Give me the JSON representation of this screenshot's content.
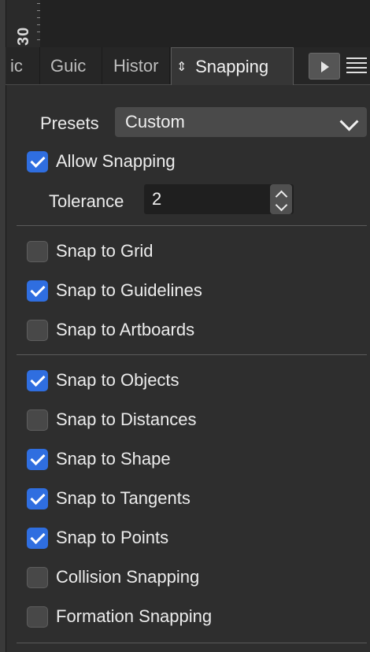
{
  "ruler": {
    "number": "30"
  },
  "tabs": [
    {
      "label": "ic",
      "active": false
    },
    {
      "label": "Guic",
      "active": false
    },
    {
      "label": "Histor",
      "active": false
    },
    {
      "label": "Snapping",
      "active": true
    }
  ],
  "presets": {
    "label": "Presets",
    "value": "Custom"
  },
  "allow_snapping": {
    "label": "Allow Snapping",
    "checked": true
  },
  "tolerance": {
    "label": "Tolerance",
    "value": "2"
  },
  "group1": [
    {
      "label": "Snap to Grid",
      "checked": false
    },
    {
      "label": "Snap to Guidelines",
      "checked": true
    },
    {
      "label": "Snap to Artboards",
      "checked": false
    }
  ],
  "group2": [
    {
      "label": "Snap to Objects",
      "checked": true
    },
    {
      "label": "Snap to Distances",
      "checked": false
    },
    {
      "label": "Snap to Shape",
      "checked": true
    },
    {
      "label": "Snap to Tangents",
      "checked": true
    },
    {
      "label": "Snap to Points",
      "checked": true
    },
    {
      "label": "Collision Snapping",
      "checked": false
    },
    {
      "label": "Formation Snapping",
      "checked": false
    }
  ],
  "colors": {
    "accent": "#2f6ee0",
    "panel_bg": "#2e2e2e"
  }
}
